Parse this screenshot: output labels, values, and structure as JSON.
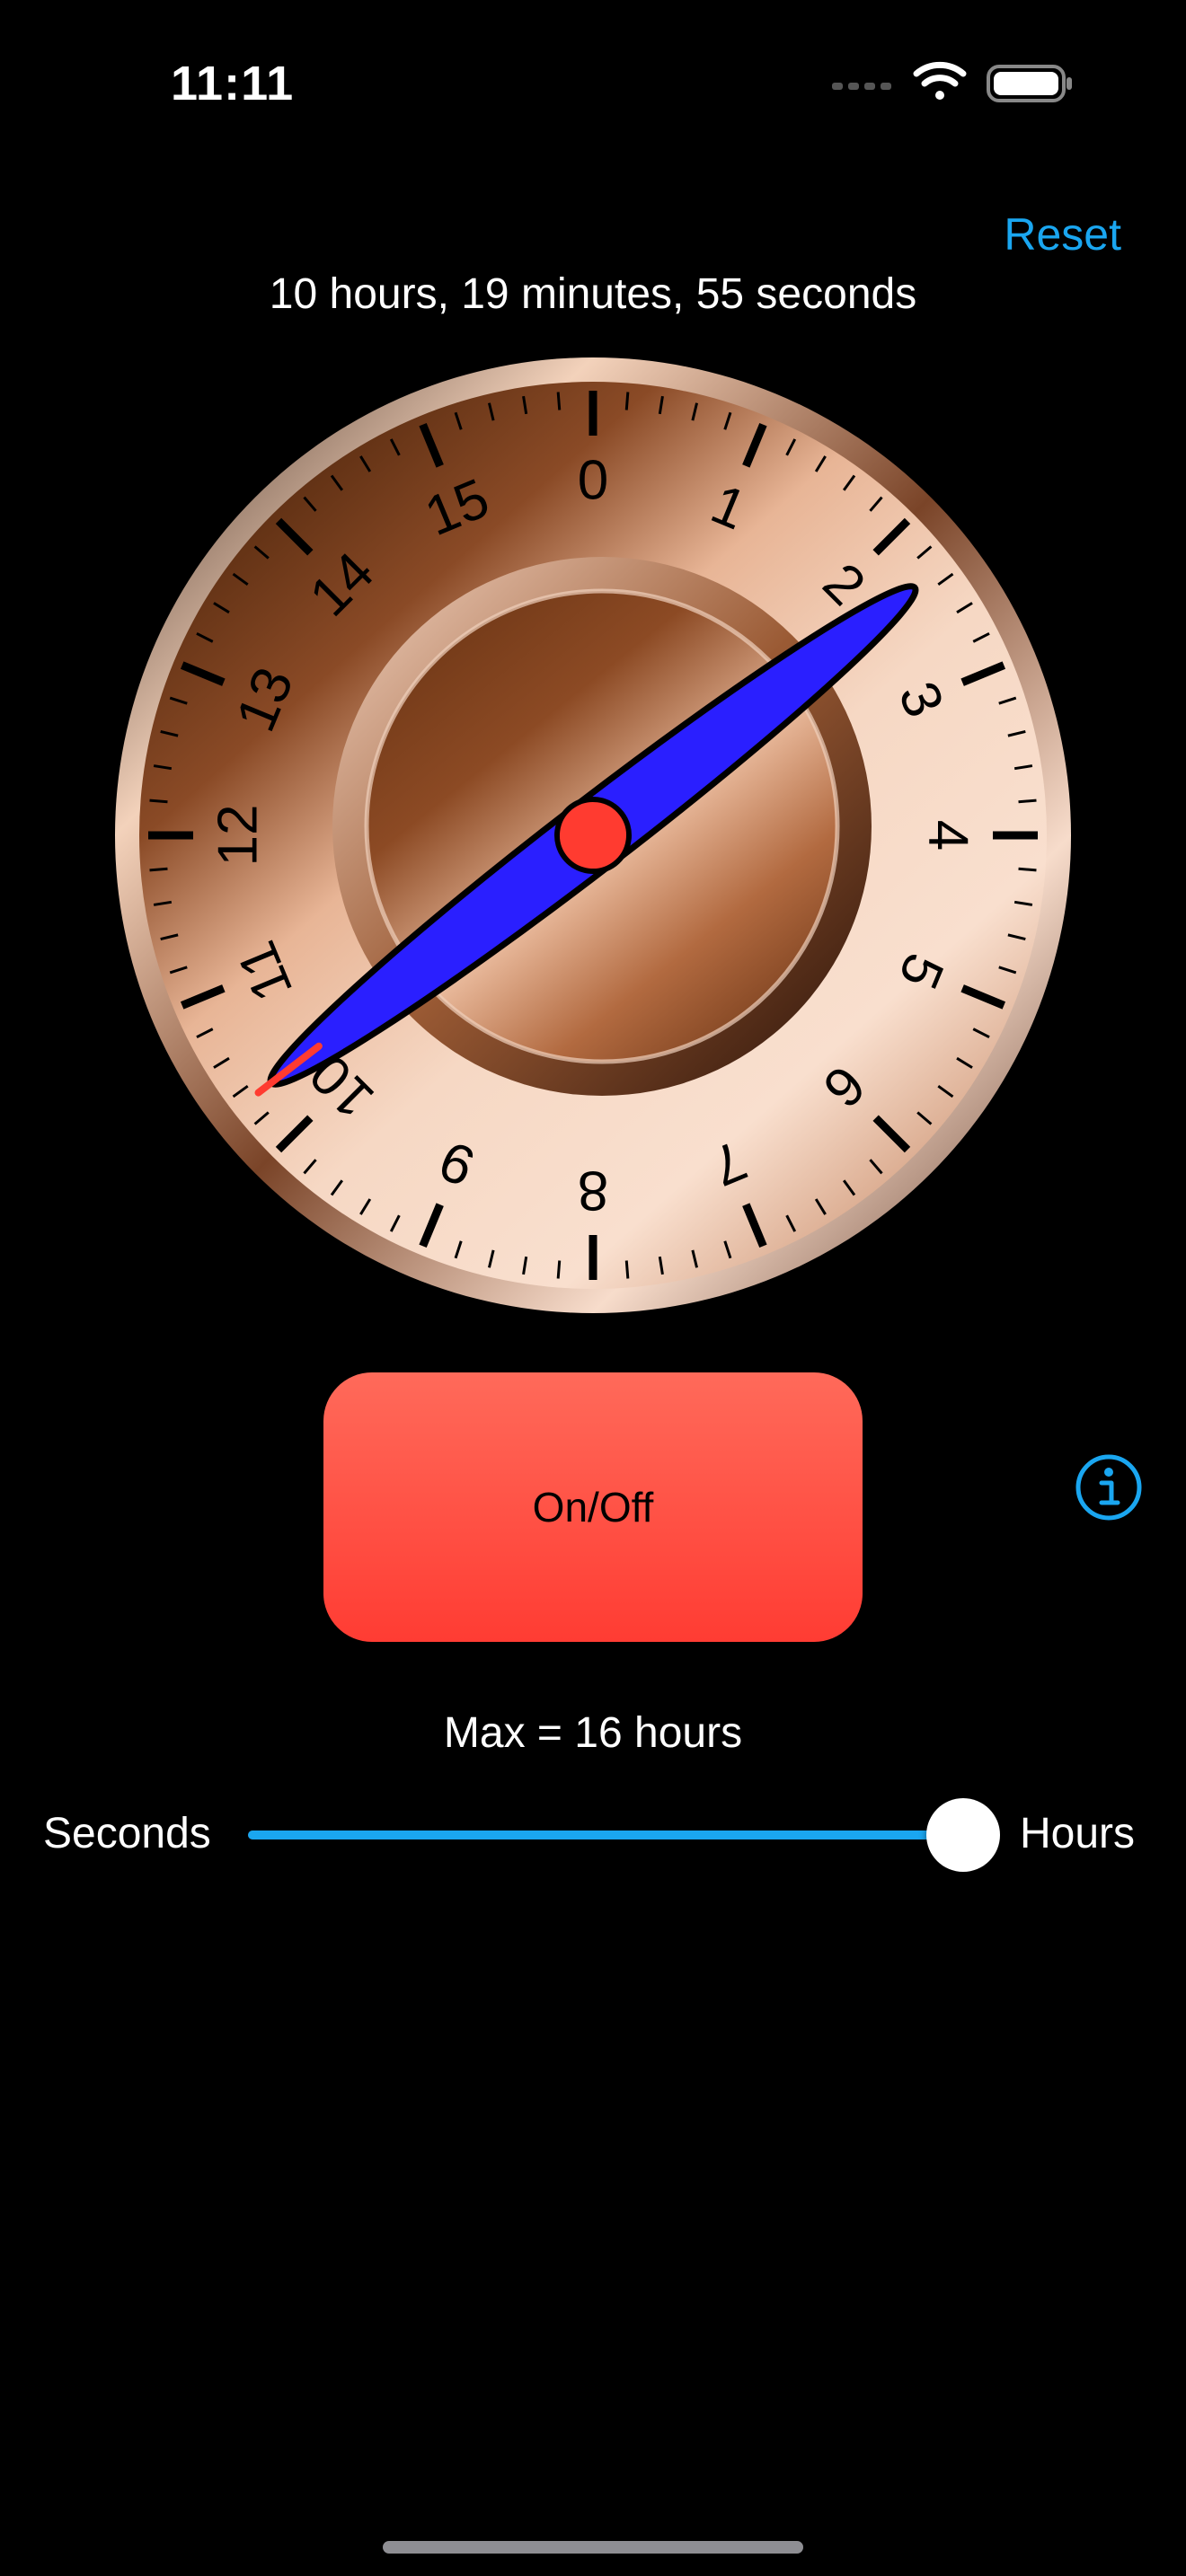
{
  "status_bar": {
    "time": "11:11"
  },
  "header": {
    "reset_label": "Reset",
    "elapsed_text": "10 hours, 19 minutes, 55 seconds"
  },
  "dial": {
    "major_labels": [
      "0",
      "1",
      "2",
      "3",
      "4",
      "5",
      "6",
      "7",
      "8",
      "9",
      "10",
      "11",
      "12",
      "13",
      "14",
      "15"
    ],
    "divisions": 16,
    "minor_ticks_per_division": 5,
    "hand_value_hours": 10.33,
    "hand_color": "#2a1fff",
    "hub_color": "#ff3b30",
    "marker_color": "#ff3b30"
  },
  "controls": {
    "onoff_label": "On/Off",
    "button_color": "#ff453a",
    "info_icon": "info-icon"
  },
  "range": {
    "max_label": "Max = 16 hours",
    "min_label": "Seconds",
    "max_label_end": "Hours",
    "slider_fraction": 1.0,
    "accent_color": "#1aa6f0"
  }
}
